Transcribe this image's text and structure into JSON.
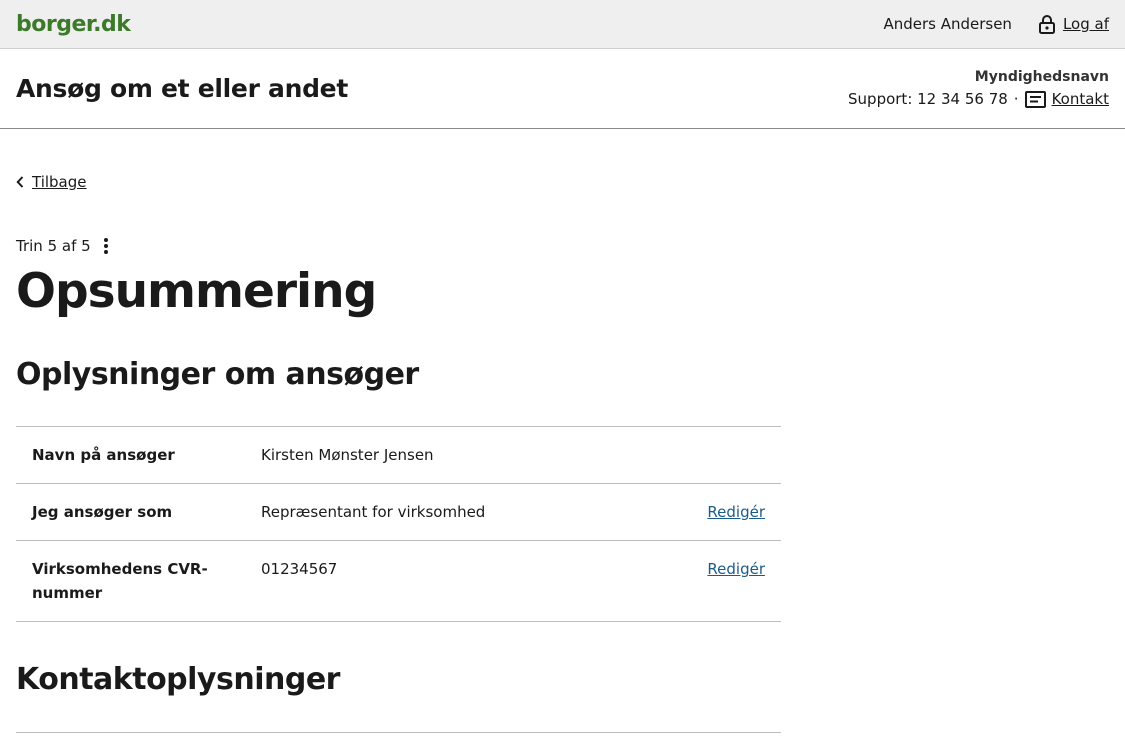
{
  "portal": {
    "logo": "borger.dk",
    "user_name": "Anders Andersen",
    "logout_label": "Log af"
  },
  "service": {
    "title": "Ansøg om et eller andet",
    "authority": "Myndighedsnavn",
    "support_text": "Support: 12 34 56 78",
    "separator": "·",
    "contact_label": "Kontakt"
  },
  "nav": {
    "back_label": "Tilbage"
  },
  "step": {
    "text": "Trin 5 af 5"
  },
  "page": {
    "heading": "Opsummering"
  },
  "applicant_section": {
    "heading": "Oplysninger om ansøger",
    "rows": [
      {
        "key": "Navn på ansøger",
        "value": "Kirsten Mønster Jensen",
        "action": ""
      },
      {
        "key": "Jeg ansøger som",
        "value": "Repræsentant for virksomhed",
        "action": "Redigér"
      },
      {
        "key": "Virksomhedens CVR-nummer",
        "value": "01234567",
        "action": "Redigér"
      }
    ]
  },
  "contact_section": {
    "heading": "Kontaktoplysninger"
  },
  "icons": {
    "logout": "lock-icon",
    "contact": "message-icon",
    "back": "chevron-left-icon",
    "menu": "kebab-menu-icon"
  },
  "colors": {
    "brand_green": "#3c7a2a",
    "link_blue": "#1a5c8c",
    "topbar_bg": "#efefef"
  }
}
